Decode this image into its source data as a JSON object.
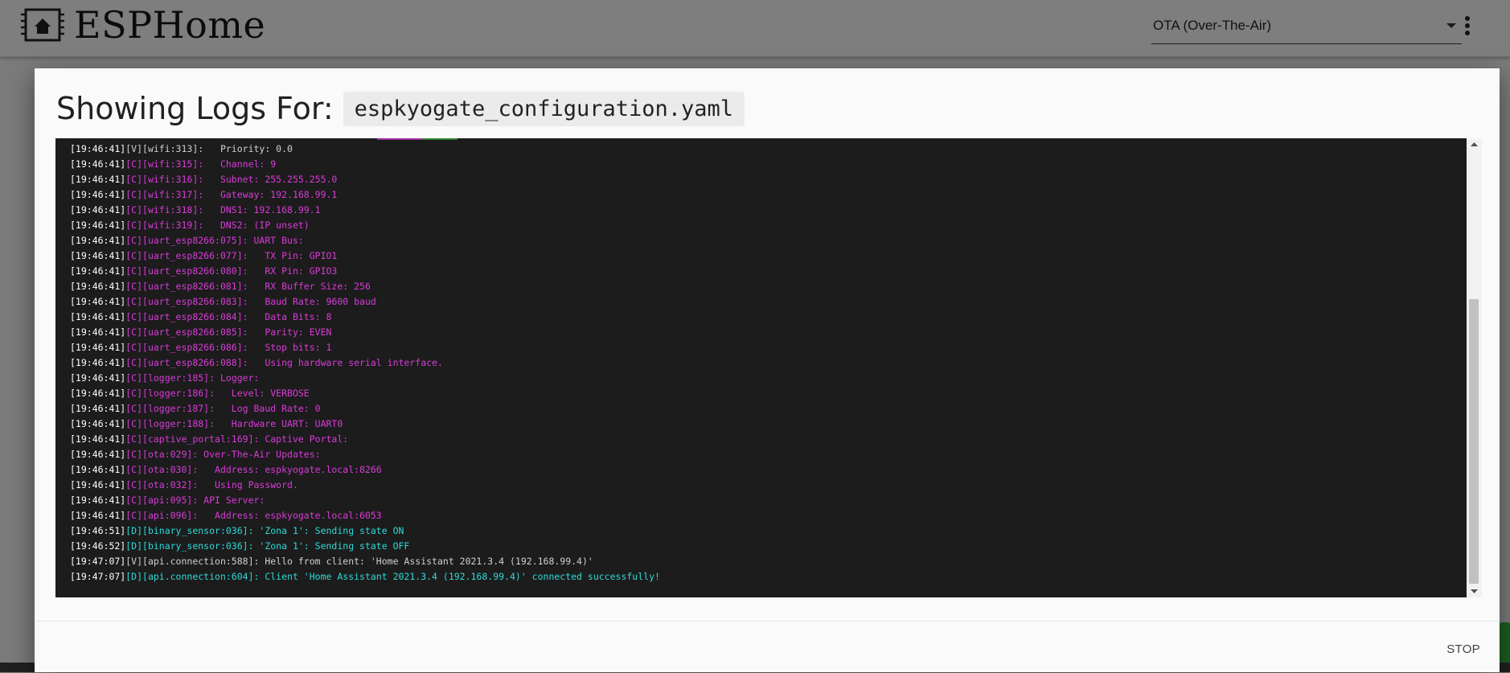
{
  "app": {
    "title": "ESPHome",
    "ota_select": {
      "value": "OTA (Over-The-Air)"
    },
    "menu_icon": "kebab-vertical-icon",
    "logo_icon": "esphome-chip-house-icon"
  },
  "modal": {
    "title_label": "Showing Logs For:",
    "filename": "espkyogate_configuration.yaml",
    "footer": {
      "stop_label": "STOP"
    }
  },
  "colors": {
    "config_line": "#d93bd9",
    "debug_line": "#2fd9d9",
    "verbose_line": "#d0d0d0",
    "timestamp": "#ffffff",
    "log_bg": "#1c1c1c"
  },
  "logs": [
    {
      "ts": "[19:46:41]",
      "lvl": "V",
      "msg": "[V][wifi:313]:   Priority: 0.0"
    },
    {
      "ts": "[19:46:41]",
      "lvl": "C",
      "msg": "[C][wifi:315]:   Channel: 9"
    },
    {
      "ts": "[19:46:41]",
      "lvl": "C",
      "msg": "[C][wifi:316]:   Subnet: 255.255.255.0"
    },
    {
      "ts": "[19:46:41]",
      "lvl": "C",
      "msg": "[C][wifi:317]:   Gateway: 192.168.99.1"
    },
    {
      "ts": "[19:46:41]",
      "lvl": "C",
      "msg": "[C][wifi:318]:   DNS1: 192.168.99.1"
    },
    {
      "ts": "[19:46:41]",
      "lvl": "C",
      "msg": "[C][wifi:319]:   DNS2: (IP unset)"
    },
    {
      "ts": "[19:46:41]",
      "lvl": "C",
      "msg": "[C][uart_esp8266:075]: UART Bus:"
    },
    {
      "ts": "[19:46:41]",
      "lvl": "C",
      "msg": "[C][uart_esp8266:077]:   TX Pin: GPIO1"
    },
    {
      "ts": "[19:46:41]",
      "lvl": "C",
      "msg": "[C][uart_esp8266:080]:   RX Pin: GPIO3"
    },
    {
      "ts": "[19:46:41]",
      "lvl": "C",
      "msg": "[C][uart_esp8266:081]:   RX Buffer Size: 256"
    },
    {
      "ts": "[19:46:41]",
      "lvl": "C",
      "msg": "[C][uart_esp8266:083]:   Baud Rate: 9600 baud"
    },
    {
      "ts": "[19:46:41]",
      "lvl": "C",
      "msg": "[C][uart_esp8266:084]:   Data Bits: 8"
    },
    {
      "ts": "[19:46:41]",
      "lvl": "C",
      "msg": "[C][uart_esp8266:085]:   Parity: EVEN"
    },
    {
      "ts": "[19:46:41]",
      "lvl": "C",
      "msg": "[C][uart_esp8266:086]:   Stop bits: 1"
    },
    {
      "ts": "[19:46:41]",
      "lvl": "C",
      "msg": "[C][uart_esp8266:088]:   Using hardware serial interface."
    },
    {
      "ts": "[19:46:41]",
      "lvl": "C",
      "msg": "[C][logger:185]: Logger:"
    },
    {
      "ts": "[19:46:41]",
      "lvl": "C",
      "msg": "[C][logger:186]:   Level: VERBOSE"
    },
    {
      "ts": "[19:46:41]",
      "lvl": "C",
      "msg": "[C][logger:187]:   Log Baud Rate: 0"
    },
    {
      "ts": "[19:46:41]",
      "lvl": "C",
      "msg": "[C][logger:188]:   Hardware UART: UART0"
    },
    {
      "ts": "[19:46:41]",
      "lvl": "C",
      "msg": "[C][captive_portal:169]: Captive Portal:"
    },
    {
      "ts": "[19:46:41]",
      "lvl": "C",
      "msg": "[C][ota:029]: Over-The-Air Updates:"
    },
    {
      "ts": "[19:46:41]",
      "lvl": "C",
      "msg": "[C][ota:030]:   Address: espkyogate.local:8266"
    },
    {
      "ts": "[19:46:41]",
      "lvl": "C",
      "msg": "[C][ota:032]:   Using Password."
    },
    {
      "ts": "[19:46:41]",
      "lvl": "C",
      "msg": "[C][api:095]: API Server:"
    },
    {
      "ts": "[19:46:41]",
      "lvl": "C",
      "msg": "[C][api:096]:   Address: espkyogate.local:6053"
    },
    {
      "ts": "[19:46:51]",
      "lvl": "D",
      "msg": "[D][binary_sensor:036]: 'Zona 1': Sending state ON"
    },
    {
      "ts": "[19:46:52]",
      "lvl": "D",
      "msg": "[D][binary_sensor:036]: 'Zona 1': Sending state OFF"
    },
    {
      "ts": "[19:47:07]",
      "lvl": "V",
      "msg": "[V][api.connection:588]: Hello from client: 'Home Assistant 2021.3.4 (192.168.99.4)'"
    },
    {
      "ts": "[19:47:07]",
      "lvl": "D",
      "msg": "[D][api.connection:604]: Client 'Home Assistant 2021.3.4 (192.168.99.4)' connected successfully!"
    }
  ]
}
